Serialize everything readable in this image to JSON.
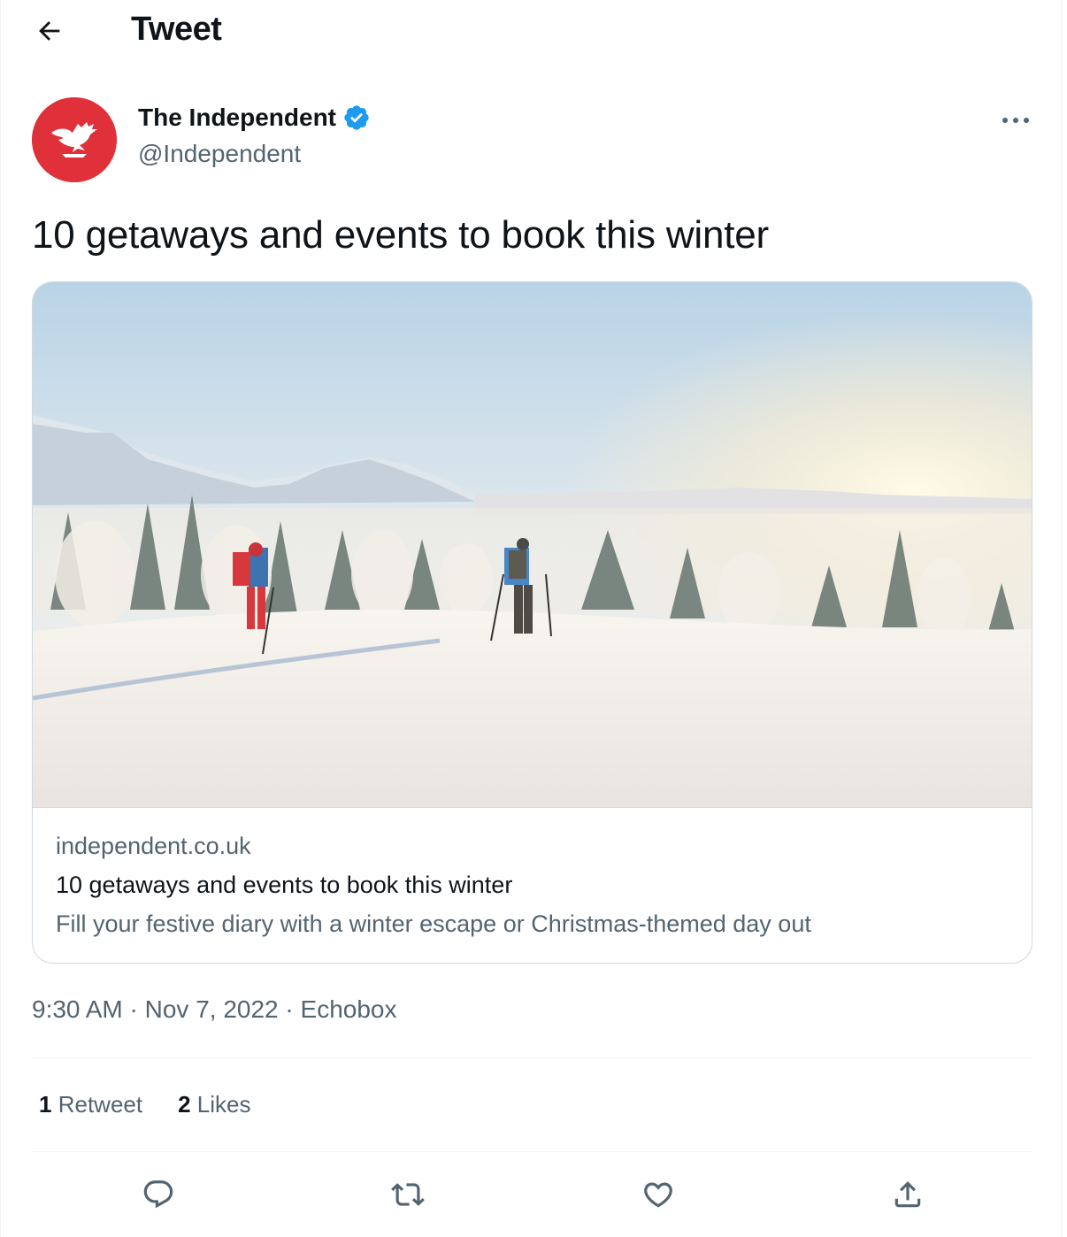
{
  "header": {
    "title": "Tweet"
  },
  "author": {
    "name": "The Independent",
    "handle": "@Independent"
  },
  "tweet": {
    "text": "10 getaways and events to book this winter"
  },
  "card": {
    "domain": "independent.co.uk",
    "title": "10 getaways and events to book this winter",
    "description": "Fill your festive diary with a winter escape or Christmas-themed day out"
  },
  "meta": {
    "time": "9:30 AM",
    "separator": " · ",
    "date": "Nov 7, 2022",
    "source": "Echobox"
  },
  "stats": {
    "retweets_count": "1",
    "retweets_label": "Retweet",
    "likes_count": "2",
    "likes_label": "Likes"
  },
  "colors": {
    "accent": "#1d9bf0",
    "brand_red": "#e0303a",
    "secondary_text": "#536471",
    "border": "#cfd9de"
  },
  "icons": [
    "back-arrow-icon",
    "verified-badge-icon",
    "more-options-icon",
    "reply-icon",
    "retweet-icon",
    "like-icon",
    "share-icon"
  ]
}
